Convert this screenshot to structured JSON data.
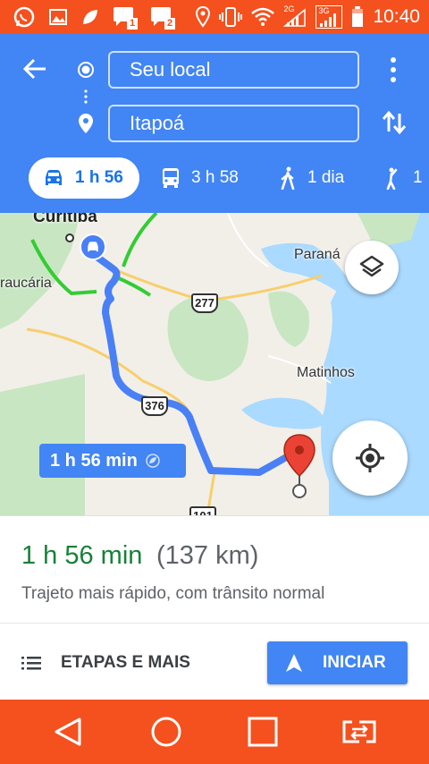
{
  "status_bar": {
    "time": "10:40",
    "notif_badge_1": "1",
    "notif_badge_2": "2",
    "network_label": "3G",
    "network_label_2": "2G"
  },
  "directions": {
    "origin_value": "Seu local",
    "destination_value": "Itapoá"
  },
  "modes": [
    {
      "name": "car",
      "label": "1 h 56",
      "active": true
    },
    {
      "name": "transit",
      "label": "3 h 58",
      "active": false
    },
    {
      "name": "walk",
      "label": "1 dia",
      "active": false
    },
    {
      "name": "ride",
      "label": "1",
      "active": false
    }
  ],
  "map": {
    "labels": {
      "curitiba": "Curitiba",
      "araucaria": "raucária",
      "paranagua": "Paraná",
      "matinhos": "Matinhos"
    },
    "highways": {
      "br277": "277",
      "br376": "376",
      "br101": "101"
    },
    "duration_bubble": "1 h 56 min",
    "colors": {
      "route": "#4a80f5",
      "water": "#aadaff",
      "park": "#c8e6c2",
      "traffic": "#33cc33"
    }
  },
  "summary": {
    "time": "1 h 56 min",
    "distance": "(137 km)",
    "description": "Trajeto mais rápido, com trânsito normal"
  },
  "actions": {
    "steps_label": "ETAPAS E MAIS",
    "start_label": "INICIAR"
  },
  "colors": {
    "header_blue": "#4285f4",
    "status_orange": "#f4511e",
    "time_green": "#188038"
  }
}
